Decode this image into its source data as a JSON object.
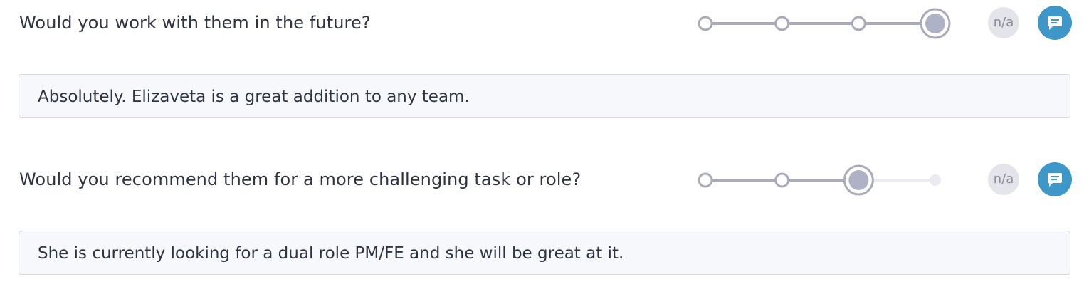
{
  "colors": {
    "track_active": "#a9abbb",
    "track_inactive": "#e9ebf1",
    "knob_fill_selected": "#afb1c4",
    "accent_blue": "#3d97c8",
    "na_background": "#e4e5ea"
  },
  "questions": [
    {
      "text": "Would you work with them in the future?",
      "rating": {
        "steps": 4,
        "selected": 4
      },
      "na_label": "n/a",
      "comment_icon": "speech-bubble-icon",
      "answer": "Absolutely. Elizaveta is a great addition to any team."
    },
    {
      "text": "Would you recommend them for a more challenging task or role?",
      "rating": {
        "steps": 4,
        "selected": 3
      },
      "na_label": "n/a",
      "comment_icon": "speech-bubble-icon",
      "answer": "She is currently looking for a dual role PM/FE and she will be great at it."
    }
  ]
}
